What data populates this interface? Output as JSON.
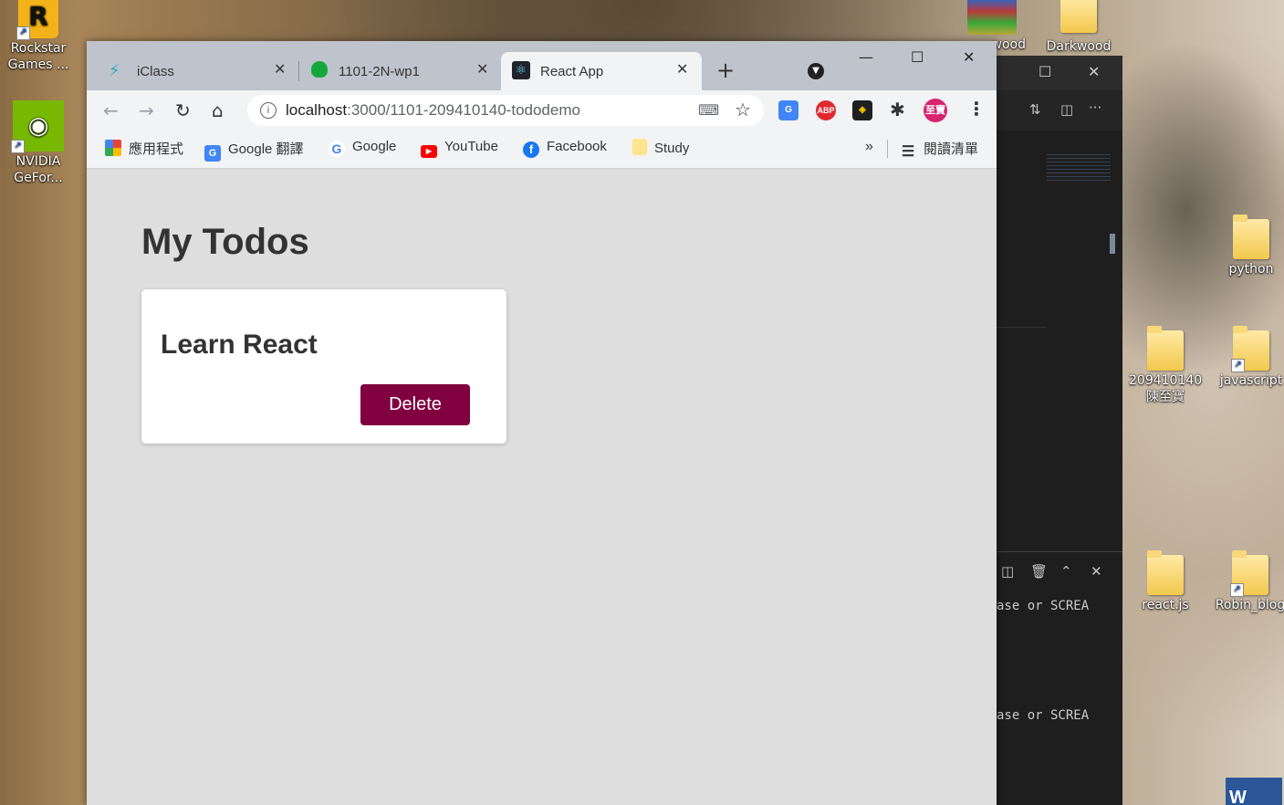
{
  "desktop": {
    "icons": [
      {
        "label_line1": "Rockstar",
        "label_line2": "Games ..."
      },
      {
        "label_line1": "NVIDIA",
        "label_line2": "GeFor..."
      },
      {
        "label_line1": "python",
        "label_line2": ""
      },
      {
        "label_line1": "209410140",
        "label_line2": "陳至寶"
      },
      {
        "label_line1": "javascript",
        "label_line2": ""
      },
      {
        "label_line1": "react.js",
        "label_line2": ""
      },
      {
        "label_line1": "Robin_blog",
        "label_line2": ""
      },
      {
        "label_line1": "wood",
        "label_line2": ""
      },
      {
        "label_line1": "Darkwood",
        "label_line2": ""
      }
    ]
  },
  "vscode": {
    "terminal_lines": [
      "ase or SCREA",
      "ase or SCREA"
    ]
  },
  "browser": {
    "tabs": [
      {
        "title": "iClass",
        "active": false
      },
      {
        "title": "1101-2N-wp1",
        "active": false
      },
      {
        "title": "React App",
        "active": true
      }
    ],
    "url_host": "localhost",
    "url_path": ":3000/1101-209410140-tododemo",
    "profile_badge": "至寶",
    "abp_badge": "ABP",
    "bookmarks": [
      {
        "label": "應用程式",
        "icon": "apps-grid-icon"
      },
      {
        "label": "Google 翻譯",
        "icon": "google-translate-icon"
      },
      {
        "label": "Google",
        "icon": "google-icon"
      },
      {
        "label": "YouTube",
        "icon": "youtube-icon"
      },
      {
        "label": "Facebook",
        "icon": "facebook-icon"
      },
      {
        "label": "Study",
        "icon": "folder-icon"
      }
    ],
    "bookmarks_overflow": "»",
    "reading_list": "閱讀清單"
  },
  "app": {
    "heading": "My Todos",
    "todos": [
      {
        "title": "Learn React",
        "delete_label": "Delete"
      }
    ],
    "accent_color": "#800040"
  }
}
